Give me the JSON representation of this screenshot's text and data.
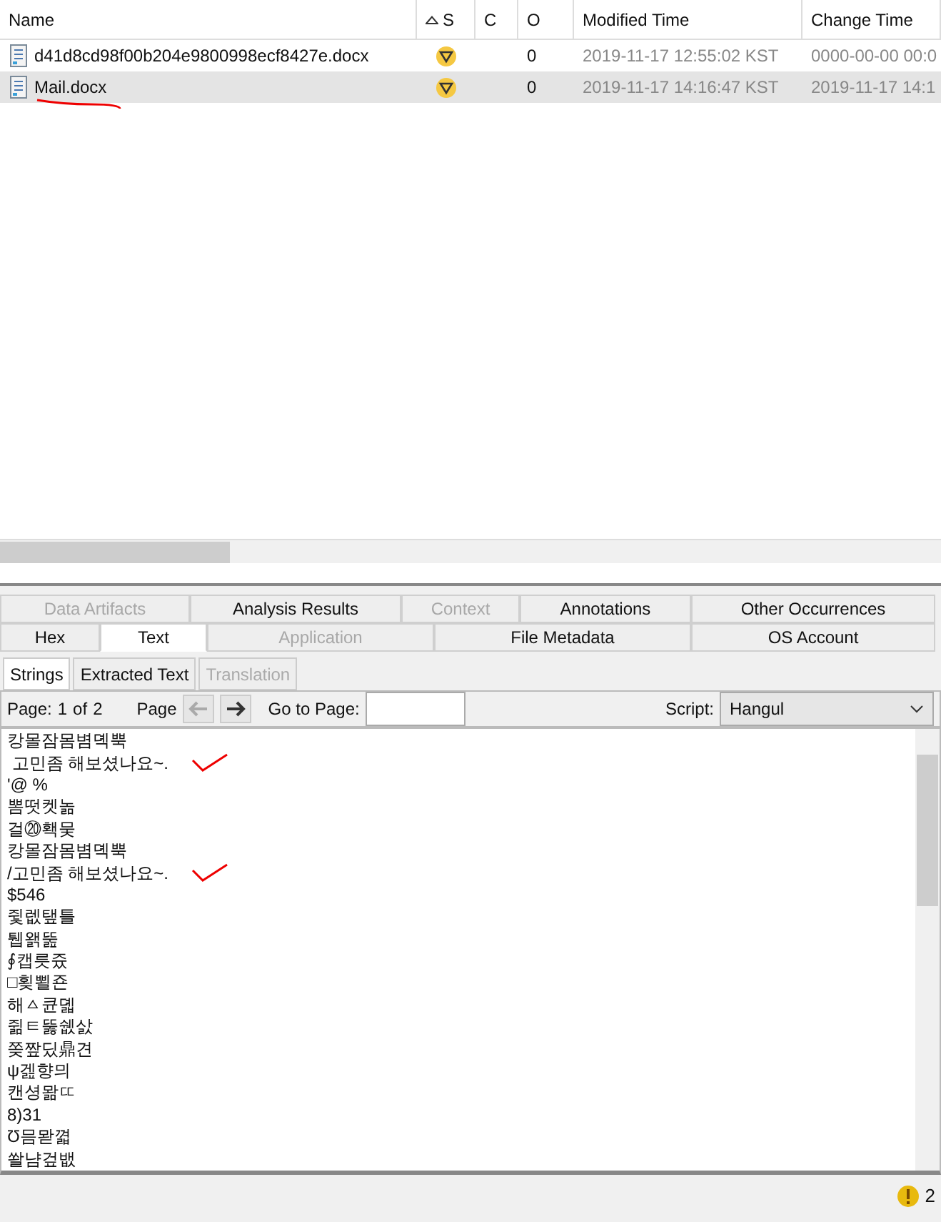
{
  "table": {
    "columns": [
      {
        "label": "Name",
        "sorted": false
      },
      {
        "label": "S",
        "sorted": true
      },
      {
        "label": "C",
        "sorted": false
      },
      {
        "label": "O",
        "sorted": false
      },
      {
        "label": "Modified Time",
        "sorted": false
      },
      {
        "label": "Change Time",
        "sorted": false
      }
    ],
    "rows": [
      {
        "name": "d41d8cd98f00b204e9800998ecf8427e.docx",
        "o": "0",
        "modified": "2019-11-17 12:55:02 KST",
        "change": "0000-00-00 00:0",
        "selected": false,
        "underlined": false
      },
      {
        "name": "Mail.docx",
        "o": "0",
        "modified": "2019-11-17 14:16:47 KST",
        "change": "2019-11-17 14:1",
        "selected": true,
        "underlined": true
      }
    ]
  },
  "tab_rows": [
    {
      "tabs": [
        {
          "label": "Data Artifacts",
          "disabled": true,
          "selected": false
        },
        {
          "label": "Analysis Results",
          "disabled": false,
          "selected": false
        },
        {
          "label": "Context",
          "disabled": true,
          "selected": false
        },
        {
          "label": "Annotations",
          "disabled": false,
          "selected": false
        },
        {
          "label": "Other Occurrences",
          "disabled": false,
          "selected": false
        }
      ]
    },
    {
      "tabs": [
        {
          "label": "Hex",
          "disabled": false,
          "selected": false
        },
        {
          "label": "Text",
          "disabled": false,
          "selected": true
        },
        {
          "label": "Application",
          "disabled": true,
          "selected": false
        },
        {
          "label": "File Metadata",
          "disabled": false,
          "selected": false
        },
        {
          "label": "OS Account",
          "disabled": false,
          "selected": false
        }
      ]
    }
  ],
  "subtabs": [
    {
      "label": "Strings",
      "disabled": false,
      "selected": true
    },
    {
      "label": "Extracted Text",
      "disabled": false,
      "selected": false
    },
    {
      "label": "Translation",
      "disabled": true,
      "selected": false
    }
  ],
  "toolbar": {
    "page_label": "Page:",
    "page": "1",
    "of": "of",
    "total": "2",
    "page_nav_label": "Page",
    "prev_disabled": true,
    "next_disabled": false,
    "goto_label": "Go to Page:",
    "script_label": "Script:",
    "script": "Hangul"
  },
  "text_lines": [
    {
      "text": "캉몰잠몸볌뎩뿍",
      "checked": false
    },
    {
      "text": " 고민좀 해보셨나요~.",
      "checked": true
    },
    {
      "text": "'@ %",
      "checked": false
    },
    {
      "text": "뽐떳켓놂",
      "checked": false
    },
    {
      "text": "걸⑳홱뭊",
      "checked": false
    },
    {
      "text": "캉몰잠몸볌뎩뿍",
      "checked": false
    },
    {
      "text": "/고민좀 해보셨나요~.",
      "checked": true
    },
    {
      "text": "$546",
      "checked": false
    },
    {
      "text": "쥧렚탶틀",
      "checked": false
    },
    {
      "text": "퉵왥뚪",
      "checked": false
    },
    {
      "text": "∮캡릇즀",
      "checked": false
    },
    {
      "text": "□횢뾜죤",
      "checked": false
    },
    {
      "text": "해ㅿ큔뎳",
      "checked": false
    },
    {
      "text": "쥚ㅌ뚫쉢삸",
      "checked": false
    },
    {
      "text": "쫒짶딨鼎견",
      "checked": false
    },
    {
      "text": "ψ겚향믜",
      "checked": false
    },
    {
      "text": "캔셩뫎ㄸ",
      "checked": false
    },
    {
      "text": "8)31",
      "checked": false
    },
    {
      "text": "Ʊ믐뫋껿",
      "checked": false
    },
    {
      "text": "쏼냠겊뱂",
      "checked": false
    }
  ],
  "status_bar": {
    "count": "2"
  }
}
